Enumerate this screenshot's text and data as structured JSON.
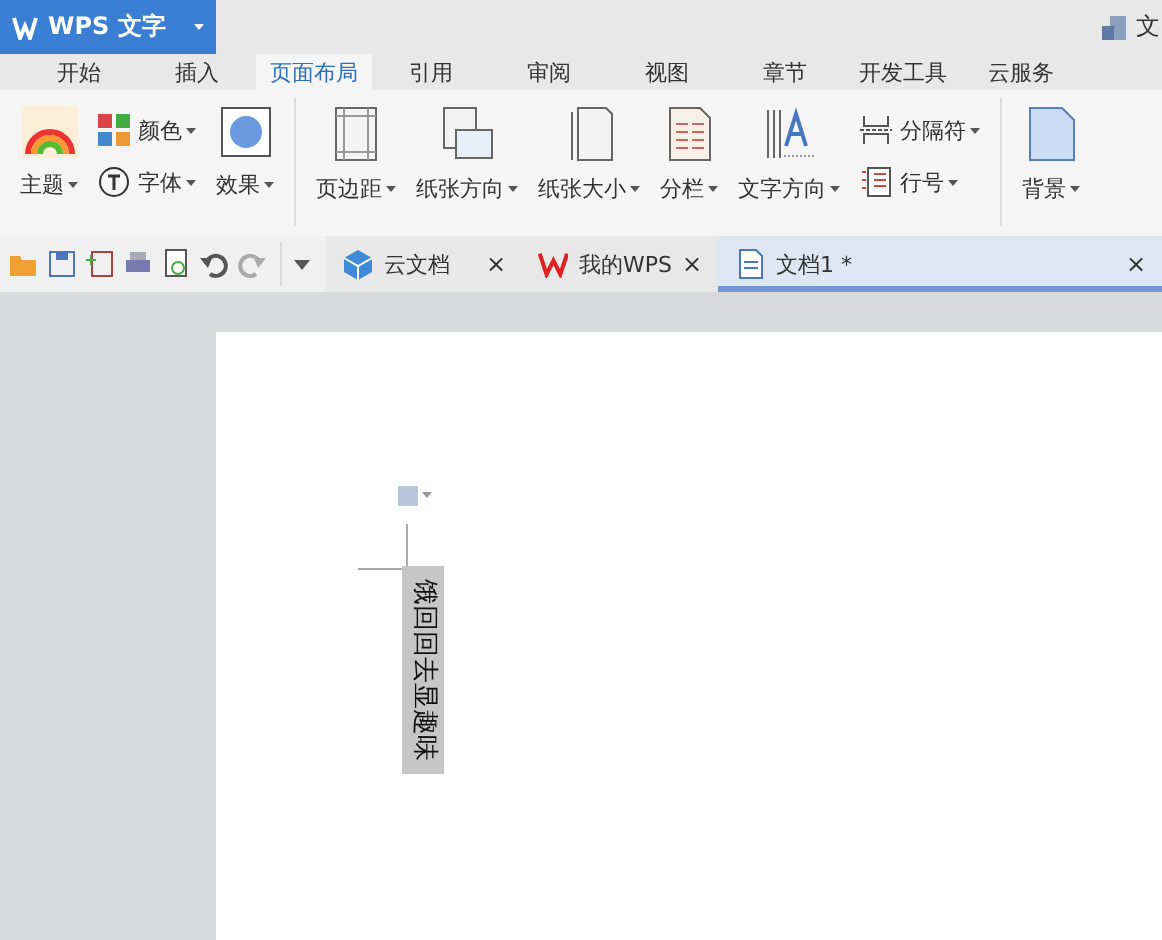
{
  "app": {
    "name": "WPS 文字",
    "top_right": "文"
  },
  "menu_tabs": [
    {
      "label": "开始",
      "selected": false
    },
    {
      "label": "插入",
      "selected": false
    },
    {
      "label": "页面布局",
      "selected": true
    },
    {
      "label": "引用",
      "selected": false
    },
    {
      "label": "审阅",
      "selected": false
    },
    {
      "label": "视图",
      "selected": false
    },
    {
      "label": "章节",
      "selected": false
    },
    {
      "label": "开发工具",
      "selected": false
    },
    {
      "label": "云服务",
      "selected": false
    }
  ],
  "ribbon": [
    {
      "kind": "large",
      "items": [
        {
          "label": "主题"
        }
      ]
    },
    {
      "kind": "stack",
      "items": [
        {
          "label": "颜色"
        },
        {
          "label": "字体"
        }
      ]
    },
    {
      "kind": "large",
      "items": [
        {
          "label": "效果"
        }
      ]
    },
    {
      "kind": "divider"
    },
    {
      "kind": "large",
      "items": [
        {
          "label": "页边距"
        }
      ]
    },
    {
      "kind": "large",
      "items": [
        {
          "label": "纸张方向"
        }
      ]
    },
    {
      "kind": "large",
      "items": [
        {
          "label": "纸张大小"
        }
      ]
    },
    {
      "kind": "large",
      "items": [
        {
          "label": "分栏"
        }
      ]
    },
    {
      "kind": "large",
      "items": [
        {
          "label": "文字方向"
        }
      ]
    },
    {
      "kind": "stack",
      "items": [
        {
          "label": "分隔符"
        },
        {
          "label": "行号"
        }
      ]
    },
    {
      "kind": "divider"
    },
    {
      "kind": "large",
      "items": [
        {
          "label": "背景"
        }
      ]
    }
  ],
  "doc_tabs": [
    {
      "label": "云文档",
      "close": "×",
      "selected": false
    },
    {
      "label": "我的WPS",
      "close": "×",
      "selected": false
    },
    {
      "label": "文档1 *",
      "close": "×",
      "selected": true
    }
  ],
  "document": {
    "text_box": "饿回回去显趣味"
  }
}
